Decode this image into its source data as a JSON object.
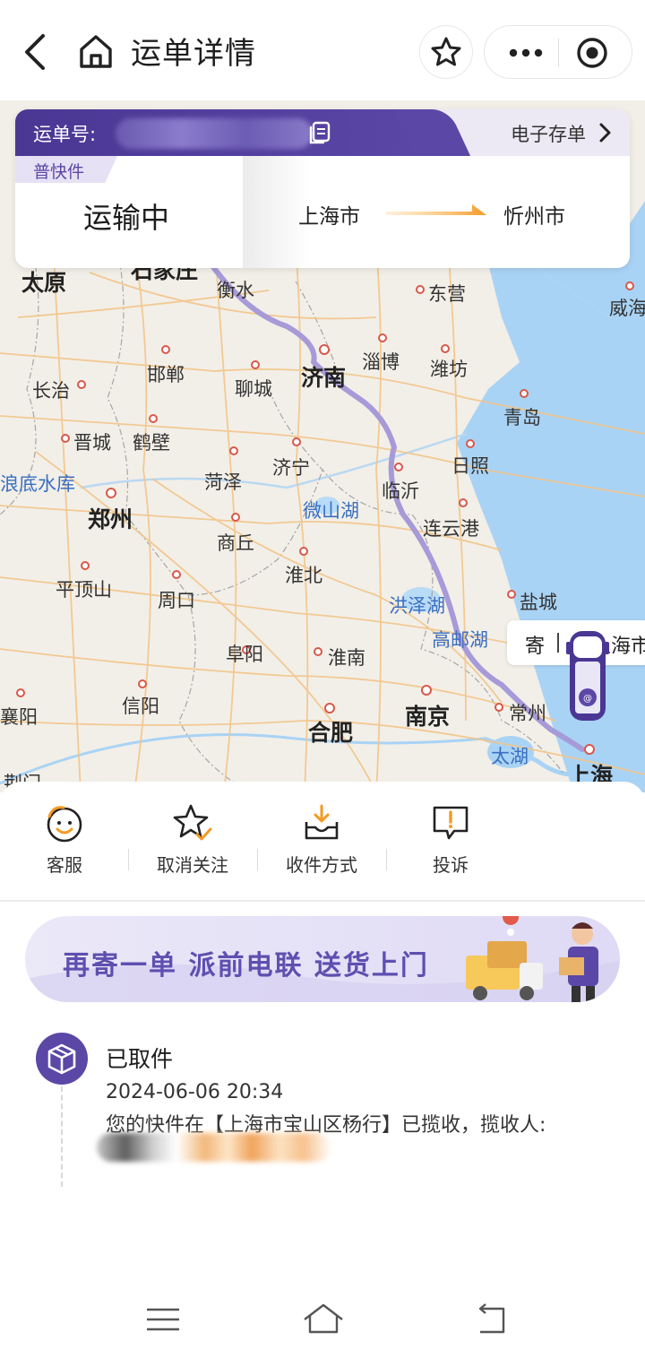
{
  "header": {
    "title": "运单详情"
  },
  "map": {
    "cities": [
      {
        "id": "taiyuan",
        "name": "太原"
      },
      {
        "id": "shijiazhuang",
        "name": "石家庄"
      },
      {
        "id": "hengshui",
        "name": "衡水"
      },
      {
        "id": "dongying",
        "name": "东营"
      },
      {
        "id": "weihai",
        "name": "威海"
      },
      {
        "id": "handan",
        "name": "邯郸"
      },
      {
        "id": "zibo",
        "name": "淄博"
      },
      {
        "id": "weifang",
        "name": "潍坊"
      },
      {
        "id": "changzhi",
        "name": "长治"
      },
      {
        "id": "liaocheng",
        "name": "聊城"
      },
      {
        "id": "jinan",
        "name": "济南"
      },
      {
        "id": "qingdao",
        "name": "青岛"
      },
      {
        "id": "jincheng",
        "name": "晋城"
      },
      {
        "id": "hebi",
        "name": "鹤壁"
      },
      {
        "id": "rizhao",
        "name": "日照"
      },
      {
        "id": "reservoir",
        "name": "浪底水库"
      },
      {
        "id": "heze",
        "name": "菏泽"
      },
      {
        "id": "jining",
        "name": "济宁"
      },
      {
        "id": "linyi",
        "name": "临沂"
      },
      {
        "id": "zhengzhou",
        "name": "郑州"
      },
      {
        "id": "weishanhu",
        "name": "微山湖"
      },
      {
        "id": "lianyungang",
        "name": "连云港"
      },
      {
        "id": "shangqiu",
        "name": "商丘"
      },
      {
        "id": "huaibei",
        "name": "淮北"
      },
      {
        "id": "pingdingshan",
        "name": "平顶山"
      },
      {
        "id": "zhoukou",
        "name": "周口"
      },
      {
        "id": "hongzehu",
        "name": "洪泽湖"
      },
      {
        "id": "yancheng",
        "name": "盐城"
      },
      {
        "id": "gaoyouhu",
        "name": "高邮湖"
      },
      {
        "id": "fuyang",
        "name": "阜阳"
      },
      {
        "id": "huainan",
        "name": "淮南"
      },
      {
        "id": "xiangyang",
        "name": "襄阳"
      },
      {
        "id": "xinyang",
        "name": "信阳"
      },
      {
        "id": "nanjing",
        "name": "南京"
      },
      {
        "id": "changzhou",
        "name": "常州"
      },
      {
        "id": "hefei",
        "name": "合肥"
      },
      {
        "id": "taihu",
        "name": "太湖"
      },
      {
        "id": "jingmen",
        "name": "荆门"
      },
      {
        "id": "shanghai",
        "name": "上海"
      }
    ],
    "sender_label": "寄",
    "sender_city": "上海市"
  },
  "waybill": {
    "number_label": "运单号:",
    "electronic_order": "电子存单",
    "tag": "普快件",
    "status": "运输中",
    "from_city": "上海市",
    "to_city": "忻州市"
  },
  "actions": [
    {
      "label": "客服"
    },
    {
      "label": "取消关注"
    },
    {
      "label": "收件方式"
    },
    {
      "label": "投诉"
    }
  ],
  "banner": {
    "text": "再寄一单  派前电联  送货上门"
  },
  "tracking": {
    "title": "已取件",
    "time": "2024-06-06 20:34",
    "description": "您的快件在【上海市宝山区杨行】已揽收，揽收人:"
  },
  "colors": {
    "brand_purple": "#5b47a6",
    "route_line": "#a79ad8",
    "water": "#a9d3f5",
    "route_arrow": "#f59a23"
  }
}
